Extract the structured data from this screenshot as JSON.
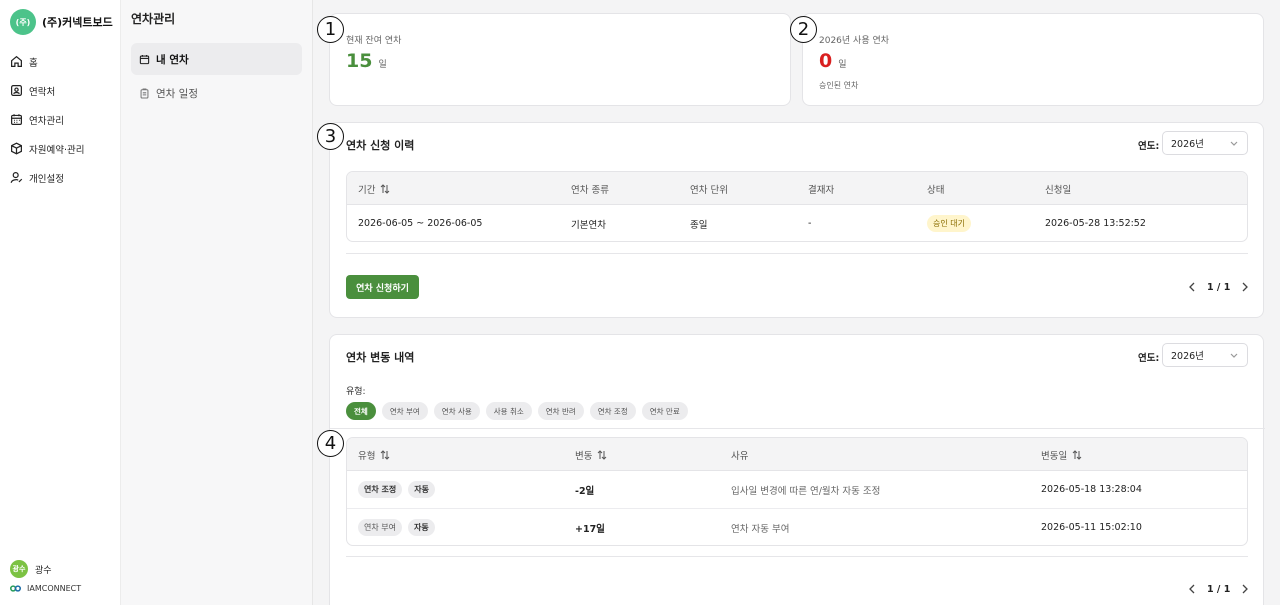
{
  "brand": {
    "logo_text": "(주)",
    "name": "(주)커넥트보드"
  },
  "nav": {
    "items": [
      {
        "label": "홈",
        "icon": "home-icon"
      },
      {
        "label": "연락처",
        "icon": "contact-icon"
      },
      {
        "label": "연차관리",
        "icon": "calendar-icon"
      },
      {
        "label": "자원예약·관리",
        "icon": "box-icon"
      },
      {
        "label": "개인설정",
        "icon": "user-settings-icon"
      }
    ],
    "user": {
      "avatar": "광수",
      "name": "광수"
    },
    "footer": "IAMCONNECT"
  },
  "subnav": {
    "title": "연차관리",
    "items": [
      {
        "label": "내 연차",
        "active": true,
        "icon": "calendar-icon"
      },
      {
        "label": "연차 일정",
        "active": false,
        "icon": "clipboard-icon"
      }
    ]
  },
  "markers": [
    "1",
    "2",
    "3",
    "4"
  ],
  "stats": {
    "remaining": {
      "label": "현재 잔여 연차",
      "value": "15",
      "unit": "일"
    },
    "used": {
      "label": "2026년 사용 연차",
      "value": "0",
      "unit": "일",
      "sub": "승인된 연차"
    }
  },
  "history": {
    "title": "연차 신청 이력",
    "year_label": "연도:",
    "year_value": "2026년",
    "columns": [
      "기간",
      "연차 종류",
      "연차 단위",
      "결재자",
      "상태",
      "신청일"
    ],
    "rows": [
      {
        "period": "2026-06-05 ~ 2026-06-05",
        "type": "기본연차",
        "unit": "종일",
        "approver": "-",
        "status": "승인 대기",
        "date": "2026-05-28 13:52:52"
      }
    ],
    "apply_button": "연차 신청하기",
    "page": "1 / 1"
  },
  "changes": {
    "title": "연차 변동 내역",
    "year_label": "연도:",
    "year_value": "2026년",
    "filter_label": "유형:",
    "filters": [
      "전체",
      "연차 부여",
      "연차 사용",
      "사용 취소",
      "연차 반려",
      "연차 조정",
      "연차 만료"
    ],
    "columns": [
      "유형",
      "변동",
      "사유",
      "변동일"
    ],
    "rows": [
      {
        "type": "연차 조정",
        "auto": "자동",
        "change": "-2일",
        "reason": "입사일 변경에 따른 연/월차 자동 조정",
        "date": "2026-05-18 13:28:04"
      },
      {
        "type": "연차 부여",
        "auto": "자동",
        "change": "+17일",
        "reason": "연차 자동 부여",
        "date": "2026-05-11 15:02:10"
      }
    ],
    "page": "1 / 1"
  },
  "colors": {
    "accent": "#4a8f3d",
    "negative": "#d92020"
  }
}
